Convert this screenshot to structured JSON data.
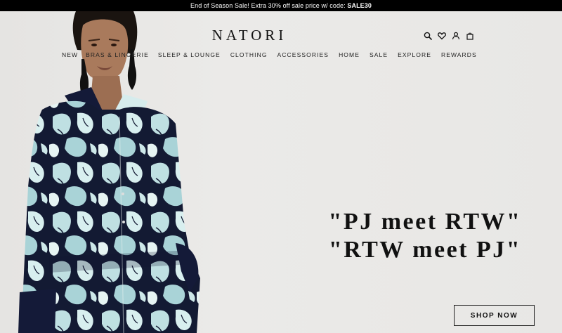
{
  "promo": {
    "text": "End of Season Sale! Extra 30% off sale price w/ code: ",
    "code": "SALE30"
  },
  "header": {
    "logo": "NATORI",
    "icons": [
      "search-icon",
      "heart-icon",
      "account-icon",
      "bag-icon"
    ]
  },
  "nav": {
    "items": [
      {
        "label": "NEW"
      },
      {
        "label": "BRAS & LINGERIE"
      },
      {
        "label": "SLEEP & LOUNGE"
      },
      {
        "label": "CLOTHING"
      },
      {
        "label": "ACCESSORIES"
      },
      {
        "label": "HOME"
      },
      {
        "label": "SALE"
      },
      {
        "label": "EXPLORE"
      },
      {
        "label": "REWARDS"
      }
    ]
  },
  "hero": {
    "headline_line1": "\"PJ meet RTW\"",
    "headline_line2": "\"RTW meet PJ\"",
    "cta": "SHOP NOW"
  }
}
